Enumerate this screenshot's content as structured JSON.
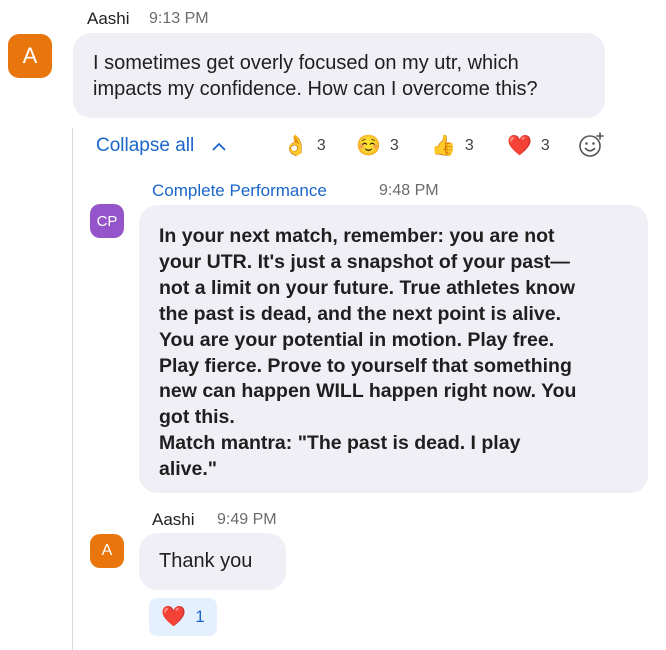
{
  "messages": [
    {
      "sender": "Aashi",
      "time": "9:13 PM",
      "avatar_initial": "A",
      "avatar_color": "#e8760c",
      "text": "I sometimes get overly focused on my utr, which impacts my confidence. How can I overcome this?"
    },
    {
      "sender": "Complete Performance",
      "time": "9:48 PM",
      "avatar_initial": "CP",
      "avatar_color": "#9355c9",
      "lines": [
        "In your next match, remember: you are not",
        "your UTR. It's just a snapshot of your past—",
        "not a limit on your future. True athletes know",
        "the past is dead, and the next point is alive.",
        "You are your potential in motion. Play free.",
        "Play fierce. Prove to yourself that something",
        "new can happen WILL happen right now. You",
        "got this.",
        "Match mantra: \"The past is dead. I play",
        "alive.\""
      ]
    },
    {
      "sender": "Aashi",
      "time": "9:49 PM",
      "avatar_initial": "A",
      "avatar_color": "#e8760c",
      "text": "Thank you"
    }
  ],
  "thread": {
    "collapse_label": "Collapse all",
    "reactions": [
      {
        "emoji": "👌",
        "count": "3",
        "icon": "ok-hand-icon"
      },
      {
        "emoji": "☺️",
        "count": "3",
        "icon": "smiling-face-icon"
      },
      {
        "emoji": "👍",
        "count": "3",
        "icon": "thumbs-up-icon"
      },
      {
        "emoji": "❤️",
        "count": "3",
        "icon": "heart-icon"
      }
    ]
  },
  "last_reaction": {
    "emoji": "❤️",
    "count": "1",
    "icon": "heart-icon"
  },
  "colors": {
    "link_blue": "#1a66c9",
    "bubble_bg": "#efeff5",
    "reaction_chip_bg": "#e5f0ff"
  }
}
